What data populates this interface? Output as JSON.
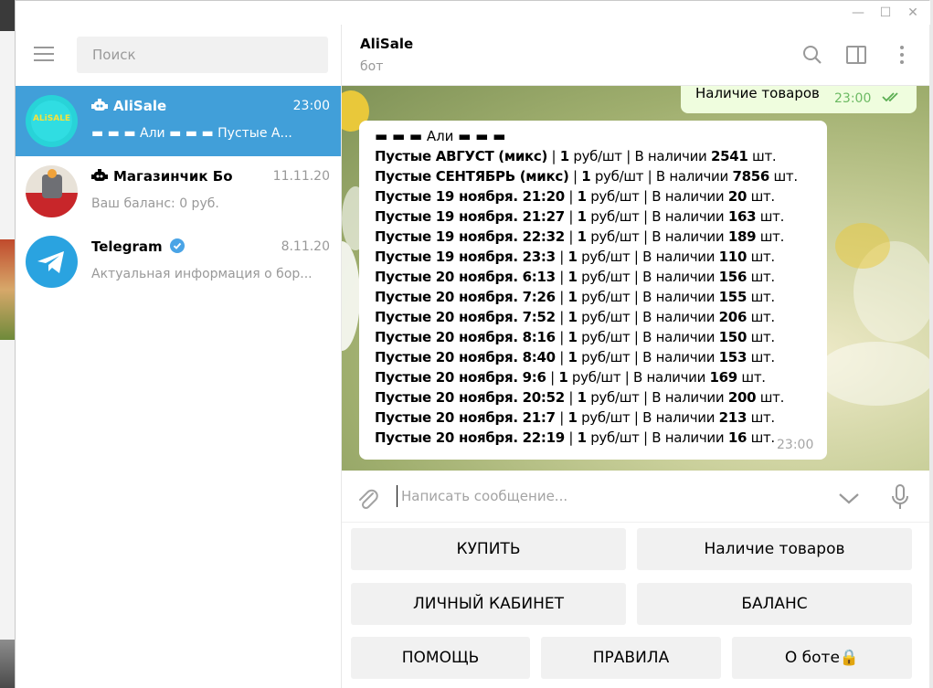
{
  "window": {
    "minimize": "—",
    "maximize": "☐",
    "close": "✕"
  },
  "search": {
    "placeholder": "Поиск"
  },
  "chats": [
    {
      "name": "AliSale",
      "time": "23:00",
      "preview": "▬ ▬ ▬ Али ▬ ▬ ▬   Пустые А...",
      "avatar_text": "ALiSALE",
      "is_bot": true,
      "active": true
    },
    {
      "name": "Магазинчик Бо",
      "time": "11.11.20",
      "preview": "Ваш баланс: 0 руб.",
      "is_bot": true,
      "active": false
    },
    {
      "name": "Telegram",
      "time": "8.11.20",
      "preview": "Актуальная информация о бор...",
      "verified": true,
      "active": false
    }
  ],
  "header": {
    "title": "AliSale",
    "status": "бот"
  },
  "messages": {
    "outgoing": {
      "text": "Наличие товаров",
      "time": "23:00"
    },
    "incoming": {
      "header": "▬ ▬ ▬ Али ▬ ▬ ▬",
      "time": "23:00",
      "lines": [
        {
          "name": "Пустые АВГУСТ (микс)",
          "price_num": "1",
          "price_unit": "руб/шт",
          "avail_label": "В наличии",
          "qty": "2541",
          "unit": "шт."
        },
        {
          "name": "Пустые СЕНТЯБРЬ (микс)",
          "price_num": "1",
          "price_unit": "руб/шт",
          "avail_label": "В наличии",
          "qty": "7856",
          "unit": "шт."
        },
        {
          "name": "Пустые 19 ноября. 21:20",
          "price_num": "1",
          "price_unit": "руб/шт",
          "avail_label": "В наличии",
          "qty": "20",
          "unit": "шт."
        },
        {
          "name": "Пустые 19 ноября. 21:27",
          "price_num": "1",
          "price_unit": "руб/шт",
          "avail_label": "В наличии",
          "qty": "163",
          "unit": "шт."
        },
        {
          "name": "Пустые 19 ноября. 22:32",
          "price_num": "1",
          "price_unit": "руб/шт",
          "avail_label": "В наличии",
          "qty": "189",
          "unit": "шт."
        },
        {
          "name": "Пустые 19 ноября. 23:3",
          "price_num": "1",
          "price_unit": "руб/шт",
          "avail_label": "В наличии",
          "qty": "110",
          "unit": "шт."
        },
        {
          "name": "Пустые 20 ноября. 6:13",
          "price_num": "1",
          "price_unit": "руб/шт",
          "avail_label": "В наличии",
          "qty": "156",
          "unit": "шт."
        },
        {
          "name": "Пустые 20 ноября. 7:26",
          "price_num": "1",
          "price_unit": "руб/шт",
          "avail_label": "В наличии",
          "qty": "155",
          "unit": "шт."
        },
        {
          "name": "Пустые 20 ноября. 7:52",
          "price_num": "1",
          "price_unit": "руб/шт",
          "avail_label": "В наличии",
          "qty": "206",
          "unit": "шт."
        },
        {
          "name": "Пустые 20 ноября. 8:16",
          "price_num": "1",
          "price_unit": "руб/шт",
          "avail_label": "В наличии",
          "qty": "150",
          "unit": "шт."
        },
        {
          "name": "Пустые 20 ноября. 8:40",
          "price_num": "1",
          "price_unit": "руб/шт",
          "avail_label": "В наличии",
          "qty": "153",
          "unit": "шт."
        },
        {
          "name": "Пустые 20 ноября. 9:6",
          "price_num": "1",
          "price_unit": "руб/шт",
          "avail_label": "В наличии",
          "qty": "169",
          "unit": "шт."
        },
        {
          "name": "Пустые 20 ноября. 20:52",
          "price_num": "1",
          "price_unit": "руб/шт",
          "avail_label": "В наличии",
          "qty": "200",
          "unit": "шт."
        },
        {
          "name": "Пустые 20 ноября. 21:7",
          "price_num": "1",
          "price_unit": "руб/шт",
          "avail_label": "В наличии",
          "qty": "213",
          "unit": "шт."
        },
        {
          "name": "Пустые 20 ноября. 22:19",
          "price_num": "1",
          "price_unit": "руб/шт",
          "avail_label": "В наличии",
          "qty": "16",
          "unit": "шт."
        }
      ]
    }
  },
  "composer": {
    "placeholder": "Написать сообщение..."
  },
  "keyboard": {
    "buy": "КУПИТЬ",
    "stock": "Наличие товаров",
    "cabinet": "ЛИЧНЫЙ КАБИНЕТ",
    "balance": "БАЛАНС",
    "help": "ПОМОЩЬ",
    "rules": "ПРАВИЛА",
    "about": "О боте🔒"
  },
  "colors": {
    "accent": "#419fd9",
    "outgoing_bubble": "#effdde",
    "check": "#5aae52"
  }
}
